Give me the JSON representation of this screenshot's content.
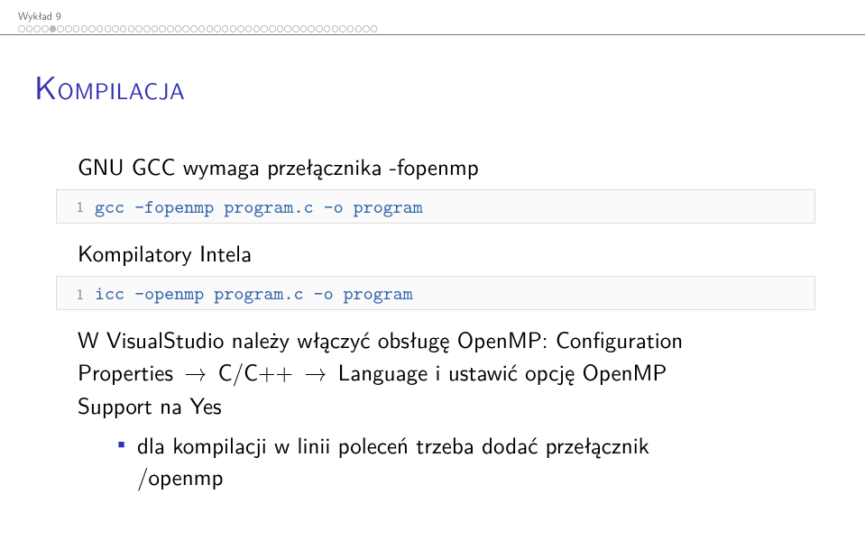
{
  "header": {
    "section": "Wykład 9",
    "progress_total": 46,
    "progress_current": 5
  },
  "title": "Kompilacja",
  "gnu": {
    "text": "GNU GCC wymaga przełącznika -fopenmp",
    "code_lineno": "1",
    "code": "gcc -fopenmp program.c -o program"
  },
  "intel": {
    "text": "Kompilatory Intela",
    "code_lineno": "1",
    "code": "icc -openmp program.c -o program"
  },
  "vs": {
    "line1": "W VisualStudio należy włączyć obsługę OpenMP: Configuration",
    "line2a": "Properties ",
    "arrow": "→",
    "line2b": " C/C++ ",
    "line2c": " Language i ustawić opcję OpenMP",
    "line3": "Support na Yes",
    "sub1a": "dla kompilacji w linii poleceń trzeba dodać przełącznik",
    "sub1b": "/openmp"
  }
}
